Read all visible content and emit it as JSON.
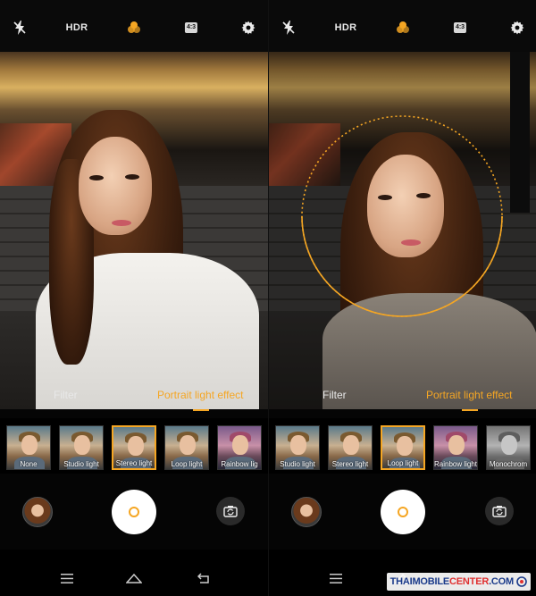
{
  "left": {
    "topbar": {
      "flash_icon": "flash-off-icon",
      "hdr_label": "HDR",
      "filter_icon": "color-filter-icon",
      "ratio_label": "4:3",
      "settings_icon": "gear-icon"
    },
    "mode_tabs": [
      {
        "label": "Filter",
        "active": false
      },
      {
        "label": "Portrait light effect",
        "active": true
      }
    ],
    "effects": [
      {
        "label": "None",
        "selected": false
      },
      {
        "label": "Studio light",
        "selected": false
      },
      {
        "label": "Stereo light",
        "selected": true
      },
      {
        "label": "Loop light",
        "selected": false
      },
      {
        "label": "Rainbow lig",
        "selected": false
      }
    ]
  },
  "right": {
    "topbar": {
      "flash_icon": "flash-off-icon",
      "hdr_label": "HDR",
      "filter_icon": "color-filter-icon",
      "ratio_label": "4:3",
      "settings_icon": "gear-icon"
    },
    "mode_tabs": [
      {
        "label": "Filter",
        "active": false
      },
      {
        "label": "Portrait light effect",
        "active": true
      }
    ],
    "effects": [
      {
        "label": "Studio light",
        "selected": false
      },
      {
        "label": "Stereo light",
        "selected": false
      },
      {
        "label": "Loop light",
        "selected": true
      },
      {
        "label": "Rainbow light",
        "selected": false
      },
      {
        "label": "Monochrom",
        "selected": false
      }
    ]
  },
  "colors": {
    "accent": "#f5a623",
    "background": "#050505"
  },
  "watermark": {
    "prefix": "THAIMOBILE",
    "accent": "CENTER",
    "suffix": ".COM"
  }
}
